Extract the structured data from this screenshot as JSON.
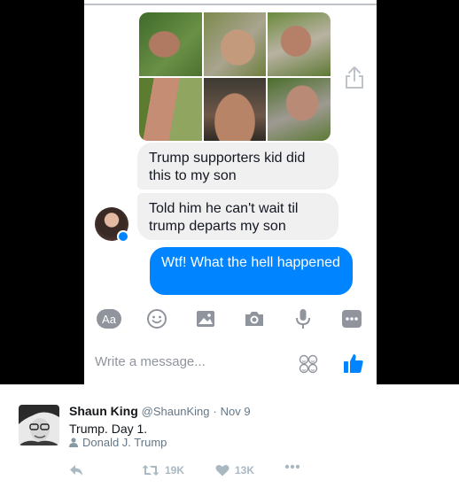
{
  "messages": {
    "incoming_1": "Trump supporters kid did this to my son",
    "incoming_2": "Told him he can't wait til trump departs my son",
    "outgoing_1": "Wtf! What the hell happened"
  },
  "composer": {
    "aa_label": "Aa",
    "placeholder": "Write a message..."
  },
  "tweet": {
    "name": "Shaun King",
    "handle": "@ShaunKing",
    "separator": "·",
    "date": "Nov 9",
    "text": "Trump. Day 1.",
    "mention": "Donald J. Trump",
    "retweets": "19K",
    "likes": "13K"
  },
  "colors": {
    "messenger_blue": "#0084ff",
    "incoming_bubble": "#f1f0f0",
    "tweet_meta": "#657786",
    "tweet_action": "#aab8c2"
  },
  "icons": [
    "share-icon",
    "emoji-icon",
    "photo-icon",
    "camera-icon",
    "microphone-icon",
    "more-icon",
    "stickers-icon",
    "thumbs-up-icon",
    "reply-icon",
    "retweet-icon",
    "heart-icon",
    "ellipsis-icon",
    "person-icon"
  ]
}
